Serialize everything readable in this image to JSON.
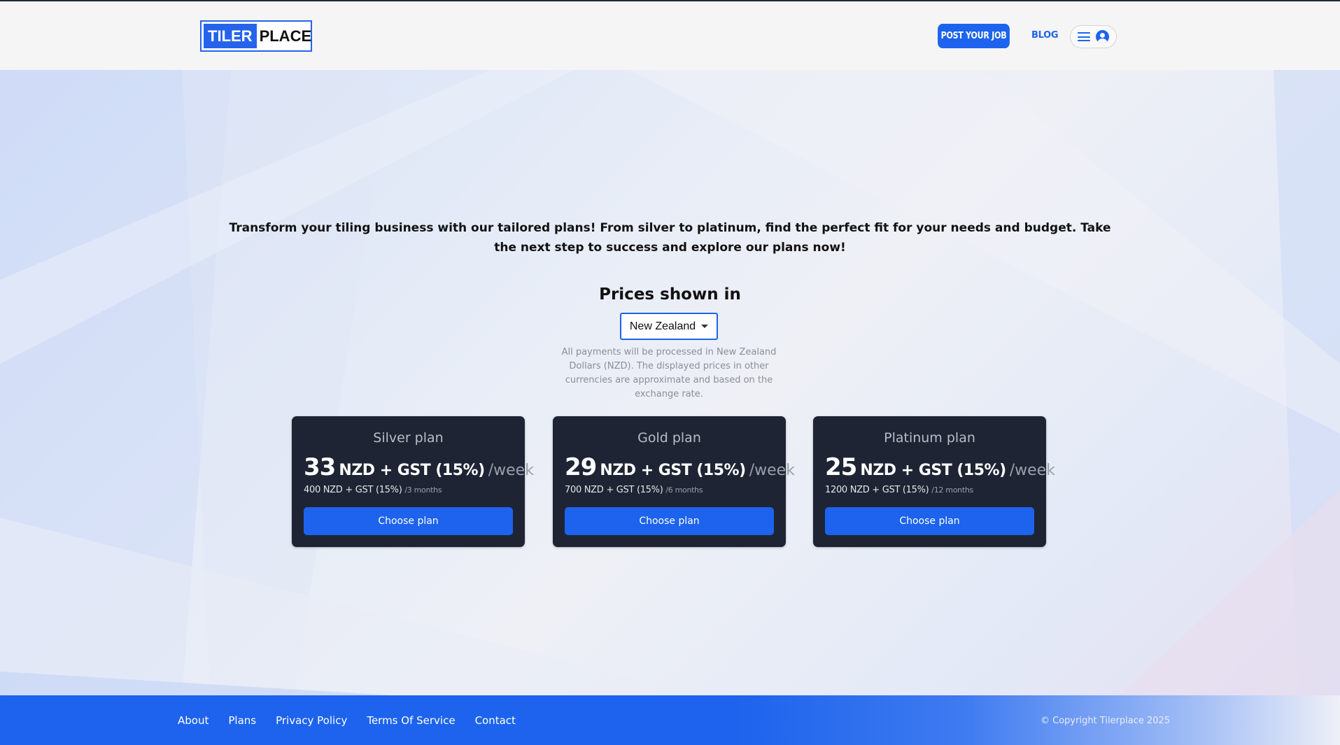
{
  "header": {
    "logo": {
      "part1": "TILER",
      "part2": "PLACE"
    },
    "post_job_label": "POST YOUR JOB",
    "blog_label": "BLOG"
  },
  "main": {
    "intro": "Transform your tiling business with our tailored plans! From silver to platinum, find the perfect fit for your needs and budget. Take the next step to success and explore our plans now!",
    "prices_title": "Prices shown in",
    "country_selected": "New Zealand",
    "payment_note": "All payments will be processed in New Zealand Dollars (NZD). The displayed prices in other currencies are approximate and based on the exchange rate.",
    "plans": [
      {
        "name": "Silver plan",
        "amount": "33",
        "currency": "NZD + GST (15%)",
        "per": "/week",
        "total": "400 NZD + GST (15%)",
        "duration": "/3 months",
        "cta": "Choose plan"
      },
      {
        "name": "Gold plan",
        "amount": "29",
        "currency": "NZD + GST (15%)",
        "per": "/week",
        "total": "700 NZD + GST (15%)",
        "duration": "/6 months",
        "cta": "Choose plan"
      },
      {
        "name": "Platinum plan",
        "amount": "25",
        "currency": "NZD + GST (15%)",
        "per": "/week",
        "total": "1200 NZD + GST (15%)",
        "duration": "/12 months",
        "cta": "Choose plan"
      }
    ]
  },
  "footer": {
    "links": [
      "About",
      "Plans",
      "Privacy Policy",
      "Terms Of Service",
      "Contact"
    ],
    "copyright": "© Copyright Tilerplace 2025"
  },
  "colors": {
    "brand_blue": "#1d63ed",
    "card_bg": "#1e2433",
    "footer_blue": "#1d63ed"
  },
  "icons": [
    "menu-icon",
    "user-icon",
    "caret-down-icon"
  ]
}
